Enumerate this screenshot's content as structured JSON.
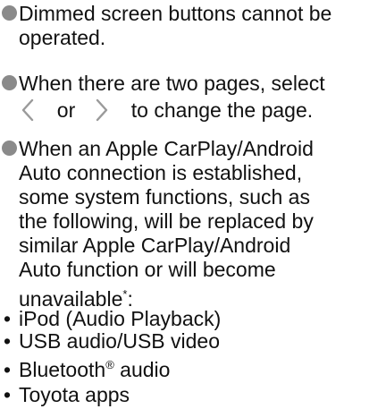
{
  "notes": [
    {
      "lines": [
        "Dimmed screen buttons cannot be",
        "operated."
      ]
    },
    {
      "lines": [
        "When there are two pages, select"
      ],
      "chevron_line": {
        "prev_icon": "chevron-left-icon",
        "connector": "or",
        "next_icon": "chevron-right-icon",
        "suffix": "to change the page."
      }
    },
    {
      "lines": [
        "When an Apple CarPlay/Android",
        "Auto connection is established,",
        "some system functions, such as",
        "the following, will be replaced by",
        "similar Apple CarPlay/Android",
        "Auto function or will become"
      ],
      "last_line": "unavailable",
      "footnote_mark": "*",
      "last_line_suffix": ":"
    }
  ],
  "functions": [
    {
      "bullet": "•",
      "text": "iPod (Audio Playback)"
    },
    {
      "bullet": "•",
      "text": "USB audio/USB video"
    },
    {
      "bullet": "•",
      "text": "Bluetooth",
      "sup": "®",
      "text_after": " audio"
    },
    {
      "bullet": "•",
      "text": "Toyota apps"
    }
  ],
  "colors": {
    "bullet_dot": "#8a8a8a",
    "chevron": "#9a9a9a",
    "text": "#111111"
  }
}
